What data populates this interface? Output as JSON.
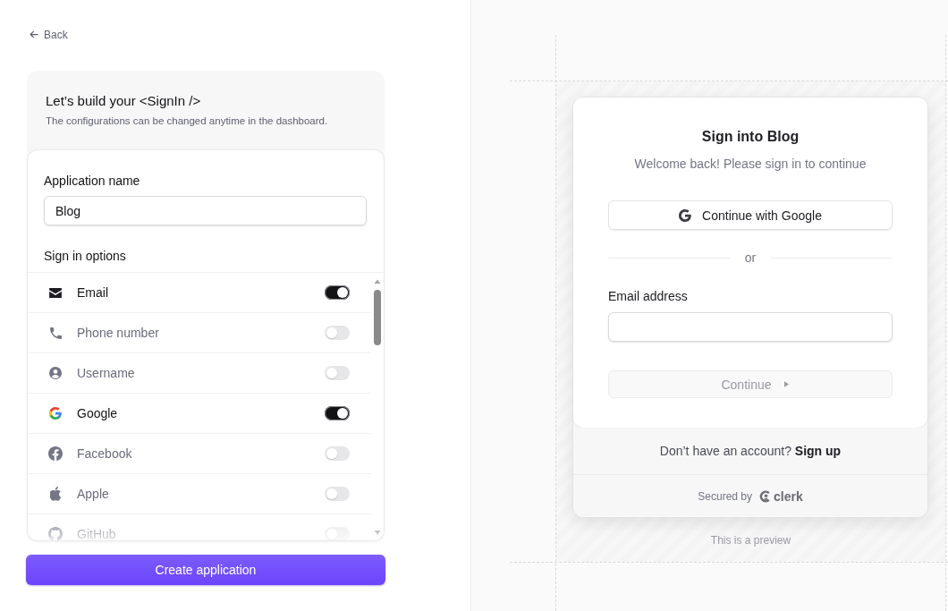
{
  "back_link": {
    "label": "Back"
  },
  "setup_card": {
    "title": "Let’s build your <SignIn />",
    "subtitle": "The configurations can be changed anytime in the dashboard.",
    "application_name": {
      "label": "Application name",
      "value": "Blog"
    },
    "sign_in_options": {
      "heading": "Sign in options",
      "items": [
        {
          "label": "Email",
          "on": true
        },
        {
          "label": "Phone number",
          "on": false
        },
        {
          "label": "Username",
          "on": false
        },
        {
          "label": "Google",
          "on": true
        },
        {
          "label": "Facebook",
          "on": false
        },
        {
          "label": "Apple",
          "on": false
        },
        {
          "label": "GitHub",
          "on": false
        }
      ]
    }
  },
  "create_button": {
    "label": "Create application"
  },
  "preview": {
    "card": {
      "title": "Sign into Blog",
      "subtitle": "Welcome back! Please sign in to continue",
      "social_button": {
        "label": "Continue with Google"
      },
      "divider": "or",
      "email_field": {
        "label": "Email address"
      },
      "continue_button": {
        "label": "Continue",
        "disabled": true
      },
      "footer": {
        "prompt": "Don’t have an account?",
        "link": "Sign up"
      },
      "secured_by": {
        "label": "Secured by",
        "logo_text": "clerk"
      }
    },
    "caption": "This is a preview"
  }
}
